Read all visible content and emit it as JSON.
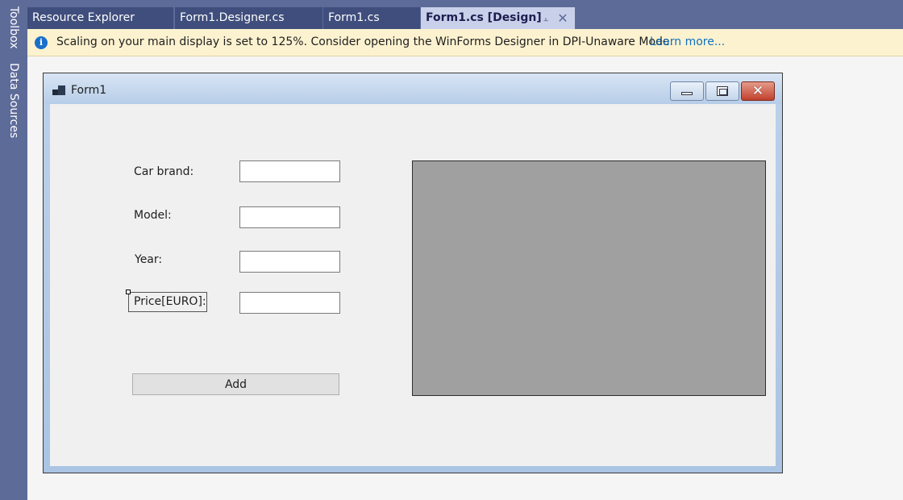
{
  "side_panel": {
    "items": [
      "Toolbox",
      "Data Sources"
    ]
  },
  "tabs": [
    {
      "label": "Resource Explorer"
    },
    {
      "label": "Form1.Designer.cs"
    },
    {
      "label": "Form1.cs"
    },
    {
      "label": "Form1.cs [Design]",
      "active": true
    }
  ],
  "tab_icons": {
    "pin": "pin-icon",
    "close": "close-icon"
  },
  "infobar": {
    "icon": "info-icon",
    "message": "Scaling on your main display is set to 125%. Consider opening the WinForms Designer in DPI-Unaware Mode.",
    "link": "Learn more..."
  },
  "form": {
    "title": "Form1",
    "icon": "form-window-icon",
    "caption_buttons": [
      "minimize-icon",
      "maximize-icon",
      "close-icon"
    ],
    "labels": {
      "brand": "Car brand:",
      "model": "Model:",
      "year": "Year:",
      "price": "Price[EURO]:"
    },
    "textboxes": {
      "brand": "",
      "model": "",
      "year": "",
      "price": ""
    },
    "add_button": "Add"
  },
  "colors": {
    "ide_chrome": "#5d6b99",
    "active_tab": "#c9d1ea",
    "infobar_bg": "#fdf2d0",
    "link": "#0e70c0",
    "form_back": "#f0f0f0",
    "picturebox": "#a0a0a0"
  }
}
